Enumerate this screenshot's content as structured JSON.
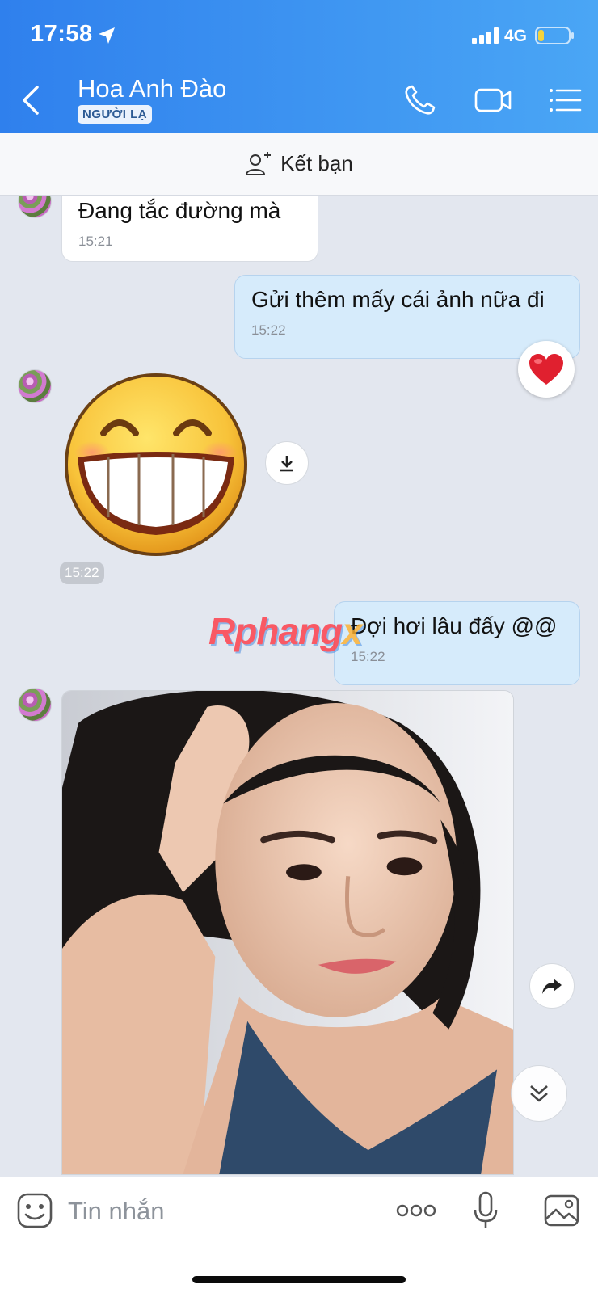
{
  "status_bar": {
    "time": "17:58",
    "network": "4G",
    "icons": [
      "location-arrow-icon",
      "signal-icon",
      "battery-icon"
    ]
  },
  "header": {
    "contact_name": "Hoa Anh Đào",
    "badge": "NGƯỜI LẠ",
    "icons": [
      "back-icon",
      "phone-icon",
      "video-icon",
      "menu-list-icon"
    ]
  },
  "add_friend": {
    "label": "Kết bạn",
    "icon": "add-person-icon"
  },
  "messages": [
    {
      "direction": "incoming",
      "type": "text",
      "text": "Đang tắc đường mà",
      "time": "15:21"
    },
    {
      "direction": "outgoing",
      "type": "text",
      "text": "Gửi thêm mấy cái ảnh nữa đi",
      "time": "15:22",
      "reaction": "heart-icon"
    },
    {
      "direction": "incoming",
      "type": "sticker",
      "sticker": "grinning-face-sticker",
      "time": "15:22"
    },
    {
      "direction": "outgoing",
      "type": "text",
      "text": "Đợi hơi lâu đấy @@",
      "time": "15:22"
    },
    {
      "direction": "incoming",
      "type": "photo"
    }
  ],
  "watermark": {
    "main": "Rphang",
    "accent": "x"
  },
  "input_bar": {
    "placeholder": "Tin nhắn",
    "icons": [
      "emoji-icon",
      "more-dots-icon",
      "microphone-icon",
      "image-icon"
    ]
  },
  "colors": {
    "header_gradient_start": "#2f80ed",
    "header_gradient_end": "#4aa6f5",
    "chat_background": "#e3e7ef",
    "outgoing_bubble": "#d6ebfb",
    "incoming_bubble": "#ffffff"
  }
}
